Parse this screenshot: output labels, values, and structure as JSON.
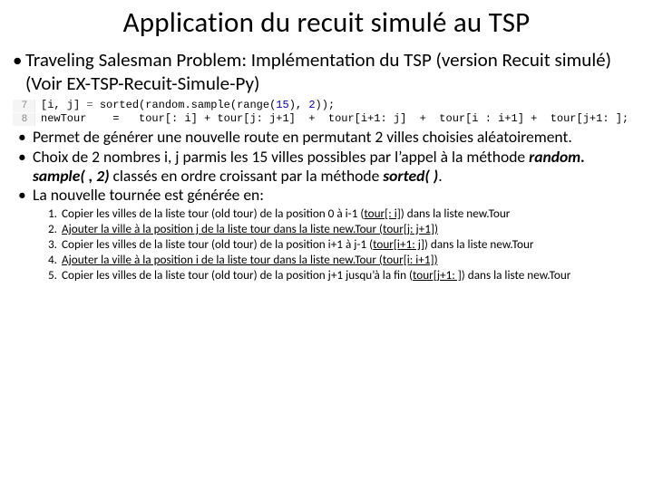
{
  "title": "Application du recuit simulé au TSP",
  "intro": "Traveling Salesman Problem: Implémentation du TSP (version Recuit simulé) (Voir EX-TSP-Recuit-Simule-Py)",
  "code": {
    "ln1": "7",
    "ln2": "8",
    "l1a": "[i, j]",
    "l1b": " = ",
    "l1c": "sorted",
    "l1d": "(random.",
    "l1e": "sample",
    "l1f": "(",
    "l1g": "range",
    "l1h": "(",
    "l1i": "15",
    "l1j": "), ",
    "l1k": "2",
    "l1l": "));",
    "l2a": "newTour",
    "l2b": "    =   tour[: i] + tour[j: j+1]  +  tour[i+1: j]  +  tour[i : i+1] +  tour[j+1: ];"
  },
  "bullets": {
    "b1": "Permet de générer une nouvelle route en permutant 2 villes choisies aléatoirement.",
    "b2a": "Choix de 2 nombres  i, j parmis les  15 villes possibles  par l’appel à la méthode ",
    "b2b": "random. sample( , 2)",
    "b2c": "  classés en ordre croissant  par la méthode  ",
    "b2d": "sorted( )",
    "b2e": ".",
    "b3": "La nouvelle tournée est générée en:"
  },
  "steps": {
    "s1a": "Copier les villes de la liste tour (old tour) de la position 0 à i-1 (",
    "s1b": "tour[: i]",
    "s1c": ")  dans la liste new.Tour",
    "s2a": " Ajouter la ville à la position j de la liste tour dans la liste new.Tour (",
    "s2b": "tour[j: j+1]",
    "s2c": ")",
    "s3a": "Copier les villes de la liste  tour (old tour) de la position i+1 à j-1 (",
    "s3b": "tour[i+1: j]",
    "s3c": ")  dans la liste new.Tour",
    "s4a": " Ajouter la ville à la position i de la liste tour dans la liste new.Tour (",
    "s4b": "tour[i: i+1]",
    "s4c": ")",
    "s5a": "Copier les villes de la liste  tour (old tour) de la position j+1 jusqu’à la fin (",
    "s5b": "tour[j+1: ]",
    "s5c": ")  dans la liste new.Tour"
  }
}
